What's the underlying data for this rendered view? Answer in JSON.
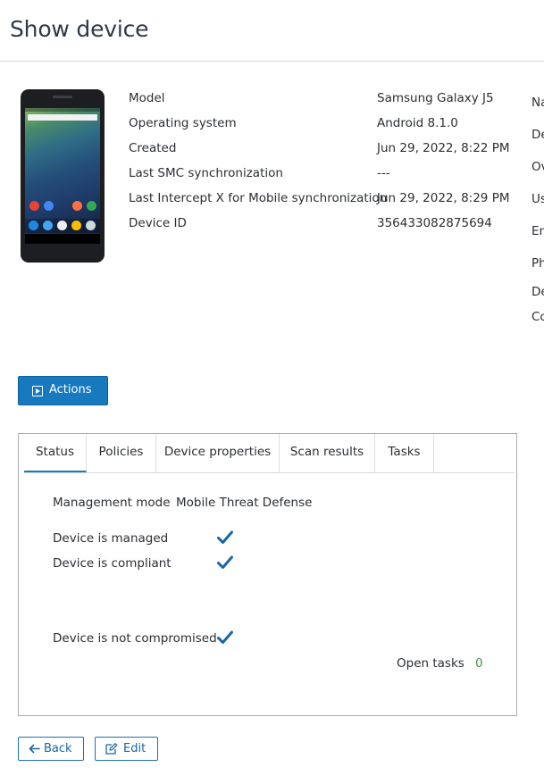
{
  "page": {
    "title": "Show device"
  },
  "device_info": [
    {
      "label": "Model",
      "value": "Samsung Galaxy J5"
    },
    {
      "label": "Operating system",
      "value": "Android 8.1.0"
    },
    {
      "label": "Created",
      "value": "Jun 29, 2022, 8:22 PM"
    },
    {
      "label": "Last SMC synchronization",
      "value": "---"
    },
    {
      "label": "Last Intercept X for Mobile synchronization",
      "value": "Jun 29, 2022, 8:29 PM"
    },
    {
      "label": "Device ID",
      "value": "356433082875694"
    }
  ],
  "side_labels_truncated": [
    "Na",
    "De",
    "Ov",
    "Us",
    "Em",
    "Ph",
    "De",
    "Co"
  ],
  "actions": {
    "label": "Actions"
  },
  "tabs": [
    {
      "label": "Status",
      "active": true
    },
    {
      "label": "Policies",
      "active": false
    },
    {
      "label": "Device properties",
      "active": false
    },
    {
      "label": "Scan results",
      "active": false
    },
    {
      "label": "Tasks",
      "active": false
    }
  ],
  "status": {
    "management_mode_label": "Management mode",
    "management_mode_value": "Mobile Threat Defense",
    "checks": [
      {
        "label": "Device is managed",
        "icon": "check-icon"
      },
      {
        "label": "Device is compliant",
        "icon": "check-icon"
      },
      {
        "label": "Device is not compromised",
        "icon": "check-icon"
      }
    ],
    "open_tasks_label": "Open tasks",
    "open_tasks_count": "0"
  },
  "footer": {
    "back_label": "Back",
    "edit_label": "Edit"
  },
  "colors": {
    "accent": "#1779be",
    "check": "#1766a8",
    "success": "#3a9a3a"
  }
}
